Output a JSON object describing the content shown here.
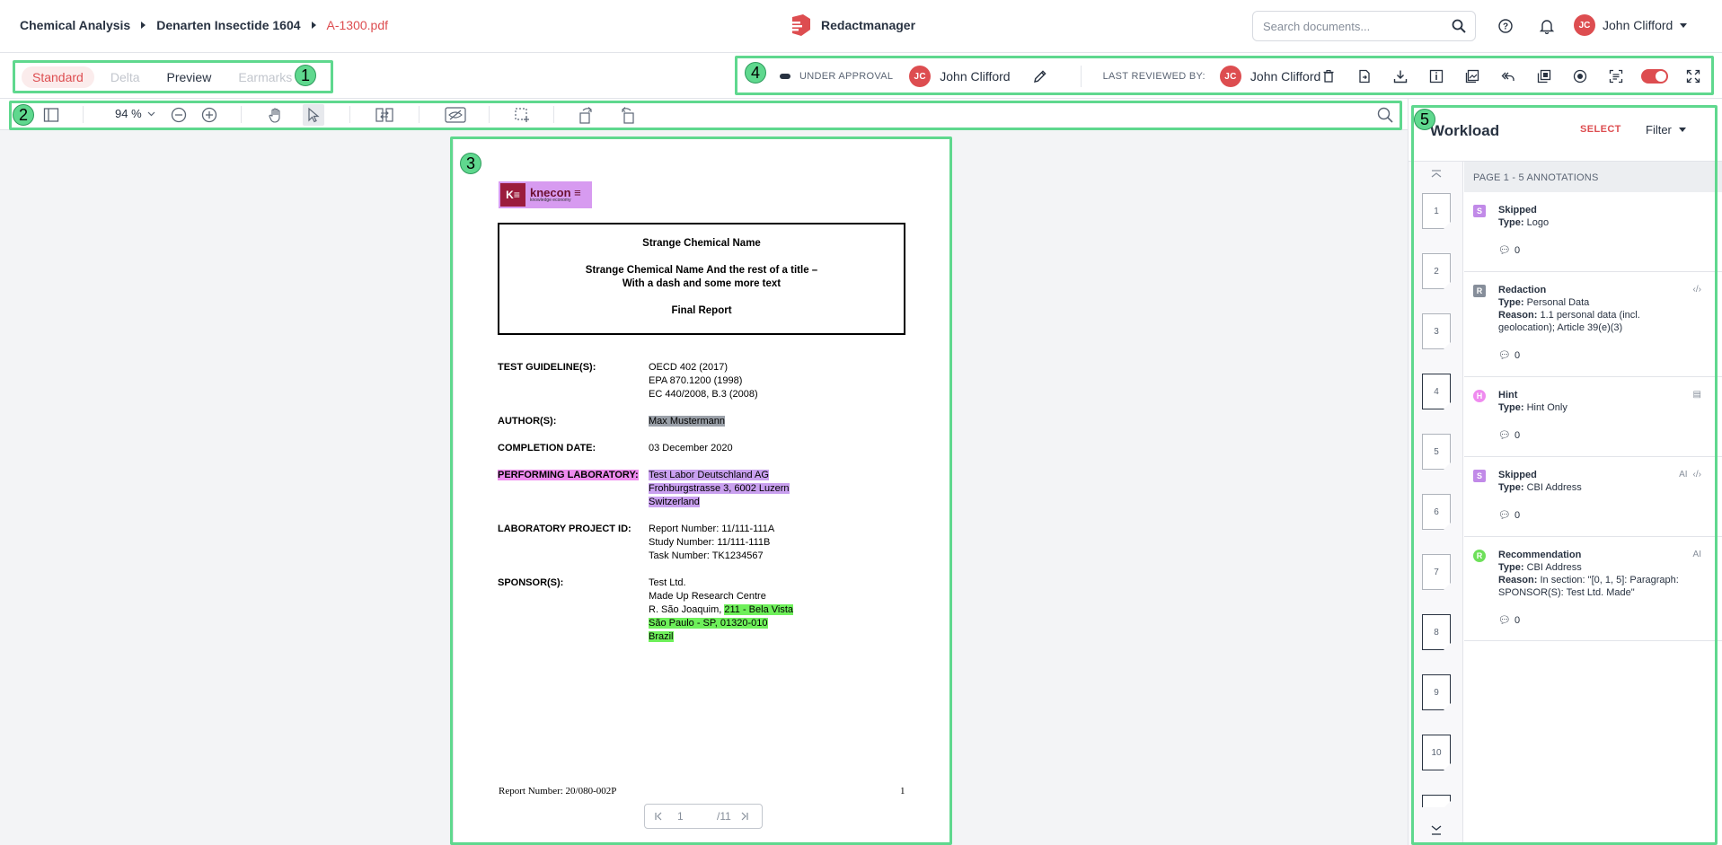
{
  "breadcrumb": {
    "items": [
      "Chemical Analysis",
      "Denarten Insectide 1604"
    ],
    "current": "A-1300.pdf"
  },
  "brand": {
    "name": "Redactmanager",
    "accent": "#dd4d50"
  },
  "search": {
    "placeholder": "Search documents..."
  },
  "user": {
    "initials": "JC",
    "name": "John Clifford"
  },
  "modes": [
    "Standard",
    "Delta",
    "Preview",
    "Earmarks"
  ],
  "status": {
    "label": "UNDER APPROVAL",
    "assignee": "John Clifford",
    "reviewed_label": "LAST REVIEWED BY:",
    "reviewer": "John Clifford",
    "reviewer_initials": "JC"
  },
  "toolbar": {
    "zoom": "94 %"
  },
  "document": {
    "logo_text": "knecon",
    "logo_sub": "knowledge economy",
    "title1": "Strange Chemical Name",
    "title2": "Strange Chemical Name And the rest of a title –",
    "title3": "With a dash and some more text",
    "title4": "Final Report",
    "fields": {
      "guideline_label": "TEST GUIDELINE(S):",
      "guideline": [
        "OECD 402 (2017)",
        "EPA 870.1200 (1998)",
        "EC 440/2008, B.3 (2008)"
      ],
      "author_label": "AUTHOR(S):",
      "author": "Max Mustermann",
      "completion_label": "COMPLETION DATE:",
      "completion": "03 December 2020",
      "lab_label": "PERFORMING LABORATORY:",
      "lab": [
        "Test Labor Deutschland AG",
        "Frohburgstrasse 3, 6002 Luzern",
        "Switzerland"
      ],
      "project_label": "LABORATORY PROJECT ID:",
      "project": [
        "Report Number: 11/111-111A",
        "Study Number: 11/111-111B",
        "Task Number: TK1234567"
      ],
      "sponsor_label": "SPONSOR(S):",
      "sponsor_1": "Test Ltd.",
      "sponsor_2": "Made Up Research Centre",
      "sponsor_3a": "R. São Joaquim, ",
      "sponsor_3b": "211 - Bela Vista",
      "sponsor_4": "São Paulo - SP, 01320-010",
      "sponsor_5": "Brazil"
    },
    "footer_left": "Report Number: 20/080-002P",
    "footer_right": "1",
    "pager_current": "1",
    "pager_total": "/11"
  },
  "workload": {
    "title": "Workload",
    "select": "SELECT",
    "filter": "Filter",
    "header": "PAGE 1 - 5 ANNOTATIONS",
    "thumbs": [
      "1",
      "2",
      "3",
      "4",
      "5",
      "6",
      "7",
      "8",
      "9",
      "10"
    ],
    "annotations": [
      {
        "badge": "S",
        "color": "#c18ae8",
        "title": "Skipped",
        "type_label": "Type:",
        "type": "Logo",
        "comments": "0"
      },
      {
        "badge": "R",
        "color": "#868e9a",
        "title": "Redaction",
        "type_label": "Type:",
        "type": "Personal Data",
        "reason_label": "Reason:",
        "reason": "1.1 personal data (incl. geolocation); Article 39(e)(3)",
        "comments": "0"
      },
      {
        "badge": "H",
        "color": "#ef8bef",
        "title": "Hint",
        "type_label": "Type:",
        "type": "Hint Only",
        "comments": "0"
      },
      {
        "badge": "S",
        "color": "#c18ae8",
        "title": "Skipped",
        "type_label": "Type:",
        "type": "CBI Address",
        "comments": "0",
        "tag": "AI"
      },
      {
        "badge": "R",
        "color": "#6ee05a",
        "title": "Recommendation",
        "type_label": "Type:",
        "type": "CBI Address",
        "reason_label": "Reason:",
        "reason": "In section: \"[0, 1, 5]: Paragraph: SPONSOR(S): Test Ltd. Made\"",
        "comments": "0",
        "tag": "AI"
      }
    ]
  },
  "markers": [
    "1",
    "2",
    "3",
    "4",
    "5"
  ]
}
